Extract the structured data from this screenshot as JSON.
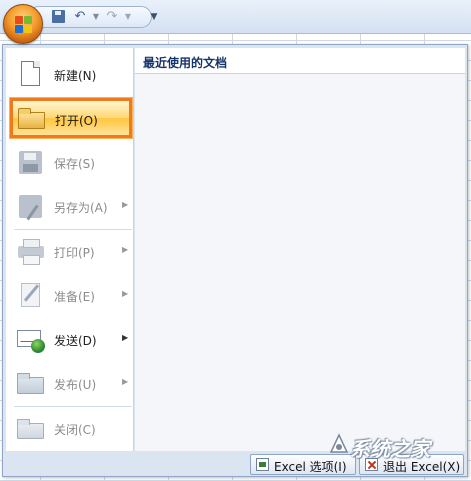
{
  "quick_access": {
    "icons": [
      "save-icon",
      "undo-icon",
      "redo-icon",
      "customize-icon"
    ]
  },
  "office_menu": {
    "items": [
      {
        "label": "新建(N)",
        "icon": "new-document-icon",
        "enabled": true,
        "submenu": false
      },
      {
        "label": "打开(O)",
        "icon": "open-folder-icon",
        "enabled": true,
        "submenu": false,
        "selected": true
      },
      {
        "label": "保存(S)",
        "icon": "save-icon",
        "enabled": false,
        "submenu": false
      },
      {
        "label": "另存为(A)",
        "icon": "save-as-icon",
        "enabled": false,
        "submenu": true
      },
      {
        "label": "打印(P)",
        "icon": "print-icon",
        "enabled": false,
        "submenu": true
      },
      {
        "label": "准备(E)",
        "icon": "prepare-icon",
        "enabled": false,
        "submenu": true
      },
      {
        "label": "发送(D)",
        "icon": "send-icon",
        "enabled": true,
        "submenu": true
      },
      {
        "label": "发布(U)",
        "icon": "publish-icon",
        "enabled": false,
        "submenu": true
      },
      {
        "label": "关闭(C)",
        "icon": "close-folder-icon",
        "enabled": false,
        "submenu": false
      }
    ],
    "recent_documents_title": "最近使用的文档",
    "options_button_label": "Excel 选项(I)",
    "exit_button_label": "退出 Excel(X)"
  },
  "watermark": {
    "text": "系统之家"
  },
  "colors": {
    "selected_border": "#ee7a1c",
    "menu_background": "#dbe5f2",
    "title_text": "#15346b"
  }
}
